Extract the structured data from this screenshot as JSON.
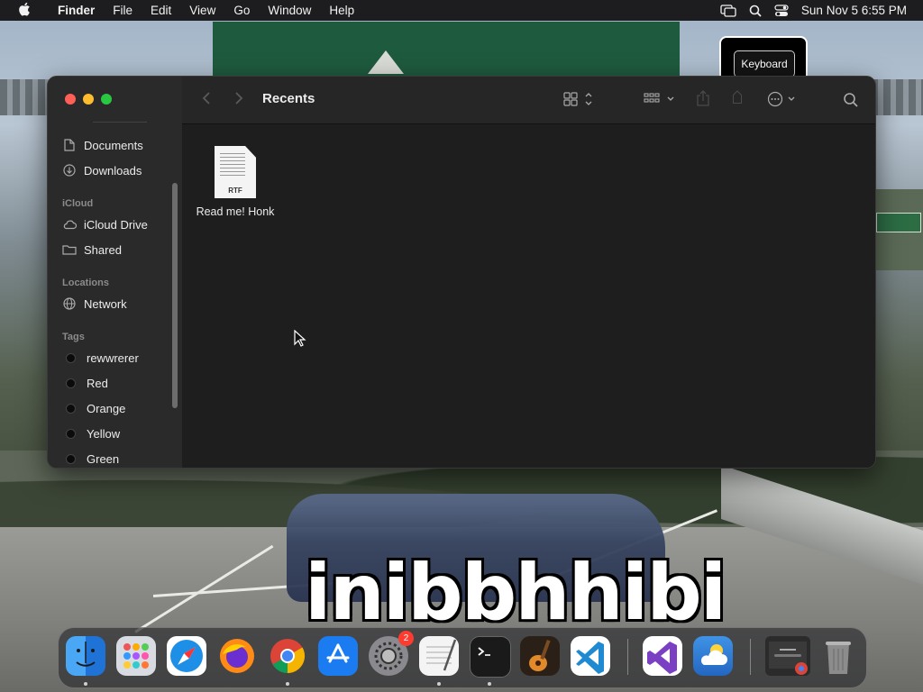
{
  "menubar": {
    "app_name": "Finder",
    "items": [
      "File",
      "Edit",
      "View",
      "Go",
      "Window",
      "Help"
    ],
    "clock": "Sun Nov 5  6:55 PM"
  },
  "keyboard_popover": {
    "label": "Keyboard"
  },
  "window": {
    "title": "Recents",
    "sidebar": {
      "favorites": [
        {
          "label": "Documents",
          "icon": "document-icon"
        },
        {
          "label": "Downloads",
          "icon": "download-icon"
        }
      ],
      "icloud_header": "iCloud",
      "icloud": [
        {
          "label": "iCloud Drive",
          "icon": "cloud-icon"
        },
        {
          "label": "Shared",
          "icon": "shared-folder-icon"
        }
      ],
      "locations_header": "Locations",
      "locations": [
        {
          "label": "Network",
          "icon": "globe-icon"
        }
      ],
      "tags_header": "Tags",
      "tags": [
        "rewwrerer",
        "Red",
        "Orange",
        "Yellow",
        "Green"
      ]
    },
    "files": [
      {
        "name": "Read me! Honk",
        "type": "RTF"
      }
    ]
  },
  "wallpaper": {
    "caption": "inibbhhibi"
  },
  "dock": {
    "apps": [
      {
        "name": "Finder",
        "color": "#2f8ef0"
      },
      {
        "name": "Launchpad",
        "color": "#d8d8e0"
      },
      {
        "name": "Safari",
        "color": "#1e8fe6"
      },
      {
        "name": "Firefox",
        "color": "#5c36c9"
      },
      {
        "name": "Chrome",
        "color": "#ffffff"
      },
      {
        "name": "App Store",
        "color": "#1b7cf2"
      },
      {
        "name": "System Settings",
        "color": "#8a8a8e",
        "badge": "2"
      },
      {
        "name": "TextEdit",
        "color": "#f2f2f2"
      },
      {
        "name": "Terminal",
        "color": "#1a1a1a"
      },
      {
        "name": "GarageBand",
        "color": "#3b2a1c"
      },
      {
        "name": "VS Code",
        "color": "#ffffff"
      },
      {
        "name": "Visual Studio",
        "color": "#ffffff"
      },
      {
        "name": "Weather",
        "color": "#2e7fd8"
      },
      {
        "name": "Chrome Window",
        "color": "#2b2b2b"
      },
      {
        "name": "Trash",
        "color": "#9a9a9a"
      }
    ]
  }
}
